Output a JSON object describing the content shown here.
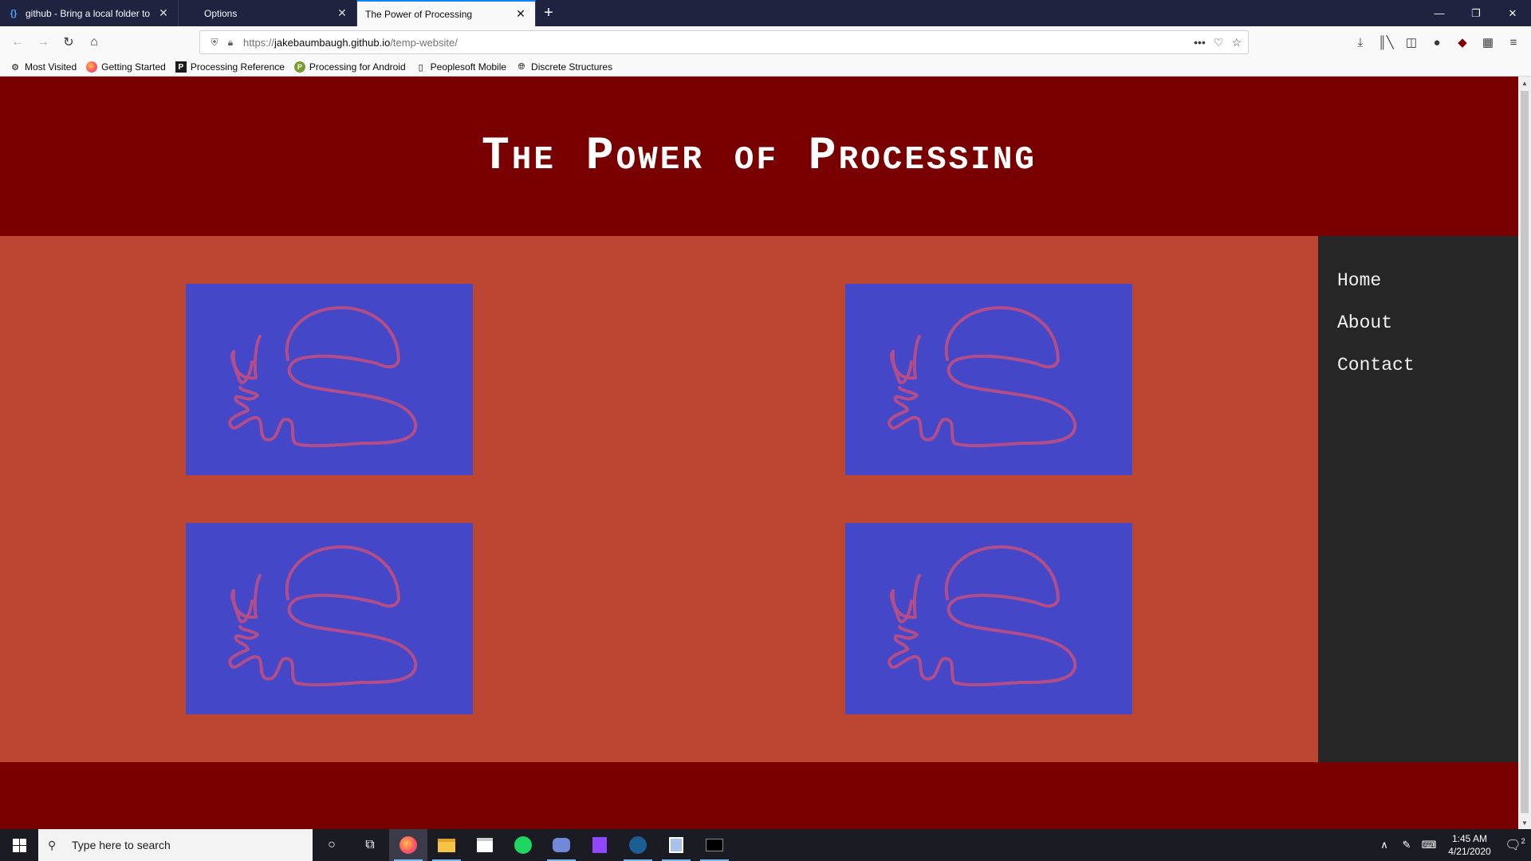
{
  "browser": {
    "tabs": [
      {
        "title": "github - Bring a local folder to ",
        "favicon": "brackets-icon"
      },
      {
        "title": "Options",
        "favicon": "gear-icon"
      },
      {
        "title": "The Power of Processing",
        "favicon": "none",
        "active": true
      }
    ],
    "url": {
      "prefix": "https://",
      "host": "jakebaumbaugh.github.io",
      "path": "/temp-website/"
    },
    "bookmarks": [
      {
        "label": "Most Visited",
        "icon": "gear-icon"
      },
      {
        "label": "Getting Started",
        "icon": "firefox-icon"
      },
      {
        "label": "Processing Reference",
        "icon": "processing-icon"
      },
      {
        "label": "Processing for Android",
        "icon": "processing-android-icon"
      },
      {
        "label": "Peoplesoft Mobile",
        "icon": "page-icon"
      },
      {
        "label": "Discrete Structures",
        "icon": "globe-icon"
      }
    ]
  },
  "page": {
    "title": "The Power of Processing",
    "nav": [
      {
        "label": "Home"
      },
      {
        "label": "About"
      },
      {
        "label": "Contact"
      }
    ],
    "colors": {
      "header": "#780000",
      "content": "#bd4632",
      "sidebar": "#262626",
      "tile": "#4448c8",
      "doodle": "#b24d8a"
    }
  },
  "taskbar": {
    "search_placeholder": "Type here to search",
    "time": "1:45 AM",
    "date": "4/21/2020",
    "notification_count": "2",
    "apps": [
      "cortana-icon",
      "task-view-icon",
      "firefox-icon",
      "file-explorer-icon",
      "store-icon",
      "spotify-icon",
      "discord-icon",
      "twitch-icon",
      "steam-icon",
      "photos-icon",
      "terminal-icon"
    ]
  }
}
